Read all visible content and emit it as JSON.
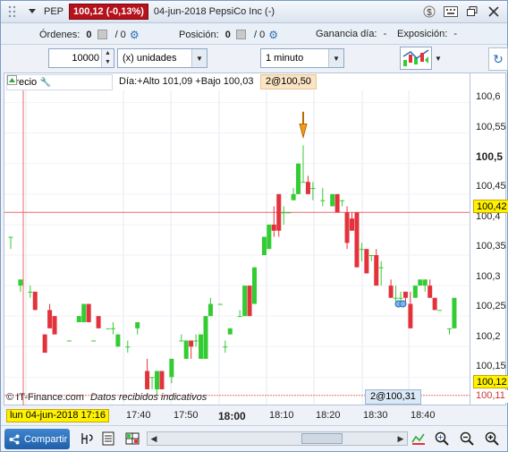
{
  "titlebar": {
    "symbol": "PEP",
    "price_change": "100,12 (-0,13%)",
    "title": "04-jun-2018 PepsiCo Inc (-)",
    "icons": [
      "dollar-icon",
      "keyboard-icon",
      "restore-icon",
      "close-icon"
    ]
  },
  "positions": {
    "orders_label": "Órdenes:",
    "orders_value": "0",
    "orders_sep": "/ 0",
    "position_label": "Posición:",
    "position_value": "0",
    "position_sep": "/ 0",
    "dayprofit_label": "Ganancia día:",
    "dayprofit_value": "-",
    "exposure_label": "Exposición:",
    "exposure_value": "-"
  },
  "toolbar": {
    "quantity": "10000",
    "units_select": "(x) unidades",
    "interval_select": "1 minuto"
  },
  "chart": {
    "price_label": "Precio",
    "day_stats": "Día:+Alto 101,09 +Bajo 100,03",
    "last_badge": "2@100,50",
    "cursor_badge": "2@100,31",
    "credit_brand": "© IT-Finance.com",
    "credit_note": "Datos recibidos indicativos",
    "y_labels": [
      "100,6",
      "100,55",
      "100,5",
      "100,45",
      "100,4",
      "100,35",
      "100,3",
      "100,25",
      "100,2",
      "100,15"
    ],
    "highlight_price": "100,42",
    "current_price": "100,12",
    "low_price": "100,11",
    "colors": {
      "up": "#33cc33",
      "down": "#e2333c",
      "crosshair": "#e86a6a",
      "highlight": "#fff200"
    }
  },
  "time_axis": {
    "cursor_datetime": "lun 04-jun-2018 17:16",
    "labels": [
      "17:40",
      "17:50",
      "18:00",
      "18:10",
      "18:20",
      "18:30",
      "18:40"
    ],
    "bold_label": "18:00"
  },
  "bottom": {
    "share_label": "Compartir"
  },
  "chart_data": {
    "type": "candlestick",
    "ylim": [
      100.105,
      100.62
    ],
    "y_ticks": [
      100.6,
      100.55,
      100.5,
      100.45,
      100.4,
      100.35,
      100.3,
      100.25,
      100.2,
      100.15
    ],
    "candles": [
      {
        "t": 0,
        "o": 100.38,
        "h": 100.38,
        "l": 100.36,
        "c": 100.38
      },
      {
        "t": 2,
        "o": 100.3,
        "h": 100.31,
        "l": 100.29,
        "c": 100.31
      },
      {
        "t": 4,
        "o": 100.29,
        "h": 100.3,
        "l": 100.28,
        "c": 100.29
      },
      {
        "t": 5,
        "o": 100.29,
        "h": 100.29,
        "l": 100.26,
        "c": 100.26
      },
      {
        "t": 7,
        "o": 100.22,
        "h": 100.22,
        "l": 100.19,
        "c": 100.19
      },
      {
        "t": 8,
        "o": 100.26,
        "h": 100.27,
        "l": 100.23,
        "c": 100.23
      },
      {
        "t": 9,
        "o": 100.25,
        "h": 100.25,
        "l": 100.22,
        "c": 100.22
      },
      {
        "t": 12,
        "o": 100.21,
        "h": 100.21,
        "l": 100.21,
        "c": 100.21
      },
      {
        "t": 14,
        "o": 100.24,
        "h": 100.25,
        "l": 100.24,
        "c": 100.25
      },
      {
        "t": 15,
        "o": 100.24,
        "h": 100.27,
        "l": 100.24,
        "c": 100.27
      },
      {
        "t": 16,
        "o": 100.27,
        "h": 100.27,
        "l": 100.24,
        "c": 100.24
      },
      {
        "t": 17,
        "o": 100.21,
        "h": 100.21,
        "l": 100.21,
        "c": 100.21
      },
      {
        "t": 18,
        "o": 100.25,
        "h": 100.25,
        "l": 100.23,
        "c": 100.23
      },
      {
        "t": 20,
        "o": 100.23,
        "h": 100.23,
        "l": 100.23,
        "c": 100.23
      },
      {
        "t": 21,
        "o": 100.23,
        "h": 100.24,
        "l": 100.22,
        "c": 100.23
      },
      {
        "t": 22,
        "o": 100.2,
        "h": 100.22,
        "l": 100.2,
        "c": 100.22
      },
      {
        "t": 24,
        "o": 100.2,
        "h": 100.21,
        "l": 100.19,
        "c": 100.2
      },
      {
        "t": 26,
        "o": 100.23,
        "h": 100.24,
        "l": 100.22,
        "c": 100.24
      },
      {
        "t": 28,
        "o": 100.16,
        "h": 100.18,
        "l": 100.13,
        "c": 100.13
      },
      {
        "t": 29,
        "o": 100.15,
        "h": 100.15,
        "l": 100.13,
        "c": 100.15
      },
      {
        "t": 30,
        "o": 100.13,
        "h": 100.16,
        "l": 100.12,
        "c": 100.16
      },
      {
        "t": 31,
        "o": 100.16,
        "h": 100.16,
        "l": 100.13,
        "c": 100.13
      },
      {
        "t": 33,
        "o": 100.15,
        "h": 100.18,
        "l": 100.14,
        "c": 100.18
      },
      {
        "t": 35,
        "o": 100.21,
        "h": 100.22,
        "l": 100.21,
        "c": 100.21
      },
      {
        "t": 36,
        "o": 100.18,
        "h": 100.21,
        "l": 100.18,
        "c": 100.21
      },
      {
        "t": 37,
        "o": 100.21,
        "h": 100.2,
        "l": 100.18,
        "c": 100.2
      },
      {
        "t": 38,
        "o": 100.21,
        "h": 100.22,
        "l": 100.2,
        "c": 100.21
      },
      {
        "t": 39,
        "o": 100.18,
        "h": 100.22,
        "l": 100.18,
        "c": 100.22
      },
      {
        "t": 40,
        "o": 100.18,
        "h": 100.25,
        "l": 100.18,
        "c": 100.25
      },
      {
        "t": 41,
        "o": 100.25,
        "h": 100.28,
        "l": 100.25,
        "c": 100.27
      },
      {
        "t": 43,
        "o": 100.27,
        "h": 100.27,
        "l": 100.27,
        "c": 100.27
      },
      {
        "t": 44,
        "o": 100.2,
        "h": 100.21,
        "l": 100.19,
        "c": 100.2
      },
      {
        "t": 45,
        "o": 100.22,
        "h": 100.23,
        "l": 100.22,
        "c": 100.23
      },
      {
        "t": 47,
        "o": 100.25,
        "h": 100.26,
        "l": 100.25,
        "c": 100.25
      },
      {
        "t": 48,
        "o": 100.25,
        "h": 100.3,
        "l": 100.25,
        "c": 100.3
      },
      {
        "t": 49,
        "o": 100.3,
        "h": 100.3,
        "l": 100.25,
        "c": 100.25
      },
      {
        "t": 50,
        "o": 100.27,
        "h": 100.33,
        "l": 100.27,
        "c": 100.33
      },
      {
        "t": 52,
        "o": 100.35,
        "h": 100.38,
        "l": 100.35,
        "c": 100.38
      },
      {
        "t": 53,
        "o": 100.36,
        "h": 100.4,
        "l": 100.36,
        "c": 100.4
      },
      {
        "t": 54,
        "o": 100.4,
        "h": 100.43,
        "l": 100.38,
        "c": 100.39
      },
      {
        "t": 55,
        "o": 100.45,
        "h": 100.45,
        "l": 100.38,
        "c": 100.39
      },
      {
        "t": 56,
        "o": 100.42,
        "h": 100.43,
        "l": 100.4,
        "c": 100.42
      },
      {
        "t": 57,
        "o": 100.42,
        "h": 100.42,
        "l": 100.42,
        "c": 100.42
      },
      {
        "t": 58,
        "o": 100.44,
        "h": 100.46,
        "l": 100.44,
        "c": 100.45
      },
      {
        "t": 59,
        "o": 100.45,
        "h": 100.5,
        "l": 100.45,
        "c": 100.5
      },
      {
        "t": 60,
        "o": 100.47,
        "h": 100.53,
        "l": 100.47,
        "c": 100.47
      },
      {
        "t": 61,
        "o": 100.47,
        "h": 100.48,
        "l": 100.45,
        "c": 100.45
      },
      {
        "t": 62,
        "o": 100.46,
        "h": 100.47,
        "l": 100.44,
        "c": 100.46
      },
      {
        "t": 64,
        "o": 100.44,
        "h": 100.46,
        "l": 100.43,
        "c": 100.44
      },
      {
        "t": 66,
        "o": 100.43,
        "h": 100.45,
        "l": 100.43,
        "c": 100.45
      },
      {
        "t": 67,
        "o": 100.45,
        "h": 100.45,
        "l": 100.42,
        "c": 100.42
      },
      {
        "t": 68,
        "o": 100.44,
        "h": 100.44,
        "l": 100.43,
        "c": 100.44
      },
      {
        "t": 69,
        "o": 100.42,
        "h": 100.43,
        "l": 100.36,
        "c": 100.37
      },
      {
        "t": 70,
        "o": 100.41,
        "h": 100.42,
        "l": 100.39,
        "c": 100.39
      },
      {
        "t": 71,
        "o": 100.42,
        "h": 100.42,
        "l": 100.33,
        "c": 100.33
      },
      {
        "t": 72,
        "o": 100.36,
        "h": 100.37,
        "l": 100.34,
        "c": 100.36
      },
      {
        "t": 73,
        "o": 100.36,
        "h": 100.36,
        "l": 100.32,
        "c": 100.32
      },
      {
        "t": 74,
        "o": 100.35,
        "h": 100.35,
        "l": 100.34,
        "c": 100.35
      },
      {
        "t": 75,
        "o": 100.35,
        "h": 100.36,
        "l": 100.3,
        "c": 100.3
      },
      {
        "t": 76,
        "o": 100.33,
        "h": 100.34,
        "l": 100.3,
        "c": 100.33
      },
      {
        "t": 78,
        "o": 100.3,
        "h": 100.31,
        "l": 100.28,
        "c": 100.28
      },
      {
        "t": 79,
        "o": 100.28,
        "h": 100.3,
        "l": 100.27,
        "c": 100.28
      },
      {
        "t": 80,
        "o": 100.28,
        "h": 100.29,
        "l": 100.27,
        "c": 100.28
      },
      {
        "t": 81,
        "o": 100.29,
        "h": 100.29,
        "l": 100.27,
        "c": 100.28
      },
      {
        "t": 82,
        "o": 100.27,
        "h": 100.29,
        "l": 100.23,
        "c": 100.23
      },
      {
        "t": 83,
        "o": 100.28,
        "h": 100.3,
        "l": 100.28,
        "c": 100.3
      },
      {
        "t": 84,
        "o": 100.3,
        "h": 100.31,
        "l": 100.3,
        "c": 100.31
      },
      {
        "t": 85,
        "o": 100.3,
        "h": 100.31,
        "l": 100.29,
        "c": 100.31
      },
      {
        "t": 86,
        "o": 100.3,
        "h": 100.31,
        "l": 100.28,
        "c": 100.28
      },
      {
        "t": 87,
        "o": 100.28,
        "h": 100.28,
        "l": 100.26,
        "c": 100.26
      },
      {
        "t": 88,
        "o": 100.26,
        "h": 100.26,
        "l": 100.26,
        "c": 100.26
      },
      {
        "t": 90,
        "o": 100.23,
        "h": 100.23,
        "l": 100.22,
        "c": 100.23
      },
      {
        "t": 91,
        "o": 100.23,
        "h": 100.28,
        "l": 100.23,
        "c": 100.28
      }
    ]
  }
}
